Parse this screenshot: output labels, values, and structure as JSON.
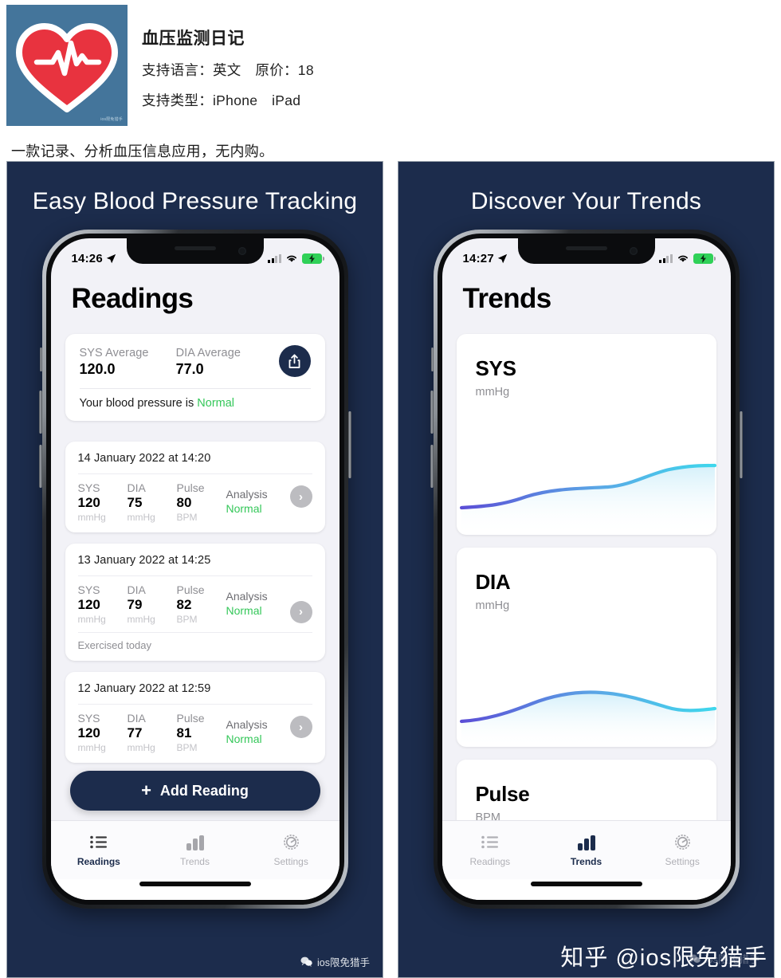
{
  "app": {
    "name": "血压监测日记",
    "language_line": "支持语言：英文　原价：18",
    "device_line": "支持类型：iPhone　iPad",
    "description": "一款记录、分析血压信息应用，无内购。",
    "icon_name": "heart-ecg-icon",
    "icon_bg": "#44759b",
    "icon_heart_color": "#e8333f",
    "icon_watermark": "ios限免猎手"
  },
  "theme": {
    "panel_bg": "#1c2c4c",
    "accent": "#1c2c4c",
    "normal_green": "#34c759",
    "muted": "#8e8e93",
    "screen_bg": "#f2f2f7"
  },
  "panels": [
    {
      "caption": "Easy Blood Pressure Tracking",
      "status": {
        "time": "14:26",
        "location_icon": "location-arrow-icon",
        "wifi_icon": "wifi-icon",
        "battery_icon": "battery-charging-icon"
      },
      "page_title": "Readings",
      "summary": {
        "sys_label": "SYS Average",
        "sys_value": "120.0",
        "dia_label": "DIA Average",
        "dia_value": "77.0",
        "share_icon": "share-icon",
        "status_prefix": "Your blood pressure is ",
        "status_value": "Normal"
      },
      "readings": [
        {
          "date": "14 January 2022 at 14:20",
          "sys_label": "SYS",
          "sys_value": "120",
          "sys_unit": "mmHg",
          "dia_label": "DIA",
          "dia_value": "75",
          "dia_unit": "mmHg",
          "pulse_label": "Pulse",
          "pulse_value": "80",
          "pulse_unit": "BPM",
          "analysis_label": "Analysis",
          "analysis_value": "Normal",
          "note": ""
        },
        {
          "date": "13 January 2022 at 14:25",
          "sys_label": "SYS",
          "sys_value": "120",
          "sys_unit": "mmHg",
          "dia_label": "DIA",
          "dia_value": "79",
          "dia_unit": "mmHg",
          "pulse_label": "Pulse",
          "pulse_value": "82",
          "pulse_unit": "BPM",
          "analysis_label": "Analysis",
          "analysis_value": "Normal",
          "note": "Exercised today"
        },
        {
          "date": "12 January 2022 at 12:59",
          "sys_label": "SYS",
          "sys_value": "120",
          "sys_unit": "mmHg",
          "dia_label": "DIA",
          "dia_value": "77",
          "dia_unit": "mmHg",
          "pulse_label": "Pulse",
          "pulse_value": "81",
          "pulse_unit": "BPM",
          "analysis_label": "Analysis",
          "analysis_value": "Normal",
          "note": ""
        }
      ],
      "add_button": {
        "icon": "plus-icon",
        "label": "Add Reading"
      },
      "tabs": [
        {
          "label": "Readings",
          "icon": "list-icon",
          "active": true
        },
        {
          "label": "Trends",
          "icon": "bar-chart-icon",
          "active": false
        },
        {
          "label": "Settings",
          "icon": "gear-icon",
          "active": false
        }
      ]
    },
    {
      "caption": "Discover Your Trends",
      "status": {
        "time": "14:27",
        "location_icon": "location-arrow-icon",
        "wifi_icon": "wifi-icon",
        "battery_icon": "battery-charging-icon"
      },
      "page_title": "Trends",
      "trend_cards": [
        {
          "title": "SYS",
          "unit": "mmHg"
        },
        {
          "title": "DIA",
          "unit": "mmHg"
        },
        {
          "title": "Pulse",
          "unit": "BPM"
        }
      ],
      "tabs": [
        {
          "label": "Readings",
          "icon": "list-icon",
          "active": false
        },
        {
          "label": "Trends",
          "icon": "bar-chart-icon",
          "active": true
        },
        {
          "label": "Settings",
          "icon": "gear-icon",
          "active": false
        }
      ]
    }
  ],
  "chart_data": [
    {
      "type": "line",
      "title": "SYS",
      "ylabel": "mmHg",
      "x": [
        0,
        1,
        2,
        3,
        4,
        5,
        6,
        7
      ],
      "values": [
        118,
        118,
        119,
        121,
        121,
        122,
        125,
        126
      ],
      "line_gradient": [
        "#5b4ed6",
        "#3fd7ec"
      ],
      "grid": false,
      "legend": "none"
    },
    {
      "type": "line",
      "title": "DIA",
      "ylabel": "mmHg",
      "x": [
        0,
        1,
        2,
        3,
        4,
        5,
        6,
        7
      ],
      "values": [
        74,
        75,
        78,
        80,
        80,
        79,
        76,
        76
      ],
      "line_gradient": [
        "#5b4ed6",
        "#3fd7ec"
      ],
      "grid": false,
      "legend": "none"
    },
    {
      "type": "line",
      "title": "Pulse",
      "ylabel": "BPM",
      "x": [],
      "values": [],
      "line_gradient": [
        "#5b4ed6",
        "#3fd7ec"
      ],
      "grid": false,
      "legend": "none"
    }
  ],
  "watermarks": {
    "small": "ios限免猎手",
    "zhihu": "知乎 @ios限免猎手",
    "ghost": "ios限免猎手"
  }
}
